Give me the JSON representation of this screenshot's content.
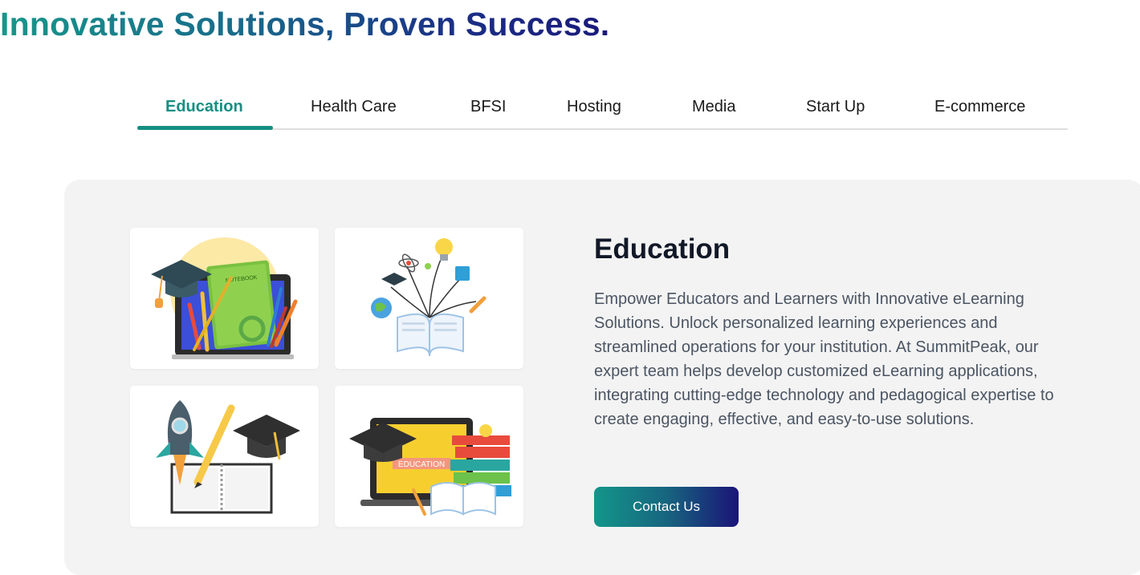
{
  "headline": "Innovative Solutions, Proven Success.",
  "tabs": [
    {
      "label": "Education",
      "active": true
    },
    {
      "label": "Health Care",
      "active": false
    },
    {
      "label": "BFSI",
      "active": false
    },
    {
      "label": "Hosting",
      "active": false
    },
    {
      "label": "Media",
      "active": false
    },
    {
      "label": "Start Up",
      "active": false
    },
    {
      "label": "E-commerce",
      "active": false
    }
  ],
  "panel": {
    "title": "Education",
    "description": "Empower Educators and Learners with Innovative eLearning Solutions. Unlock personalized learning experiences and streamlined operations for your institution. At SummitPeak, our expert team helps develop customized eLearning applications, integrating cutting-edge technology and pedagogical expertise to create engaging, effective, and easy-to-use solutions.",
    "cta_label": "Contact Us",
    "images": [
      {
        "icon": "tablet-school-supplies-illustration",
        "text": "NOTEBOOK"
      },
      {
        "icon": "open-book-ideas-illustration"
      },
      {
        "icon": "rocket-pencil-notebook-illustration"
      },
      {
        "icon": "laptop-graduation-books-illustration",
        "text": "EDUCATION"
      }
    ]
  },
  "colors": {
    "accent": "#148f82",
    "gradient_start": "#13968a",
    "gradient_end": "#1a1478"
  }
}
